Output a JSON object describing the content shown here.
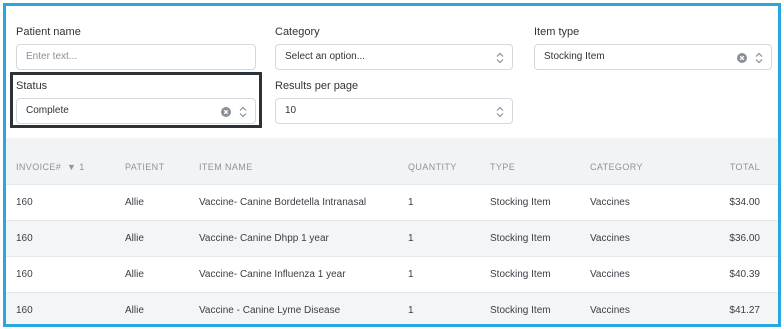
{
  "filters": {
    "patient_name": {
      "label": "Patient name",
      "placeholder": "Enter text..."
    },
    "category": {
      "label": "Category",
      "value": "Select an option..."
    },
    "item_type": {
      "label": "Item type",
      "value": "Stocking Item"
    },
    "status": {
      "label": "Status",
      "value": "Complete"
    },
    "results_per_page": {
      "label": "Results per page",
      "value": "10"
    }
  },
  "table": {
    "headers": {
      "invoice": "INVOICE#",
      "sort_indicator": "▼ 1",
      "patient": "PATIENT",
      "item_name": "ITEM NAME",
      "quantity": "QUANTITY",
      "type": "TYPE",
      "category": "CATEGORY",
      "total": "TOTAL"
    },
    "rows": [
      {
        "invoice": "160",
        "patient": "Allie",
        "item_name": "Vaccine- Canine Bordetella Intranasal",
        "quantity": "1",
        "type": "Stocking Item",
        "category": "Vaccines",
        "total": "$34.00"
      },
      {
        "invoice": "160",
        "patient": "Allie",
        "item_name": "Vaccine- Canine Dhpp 1 year",
        "quantity": "1",
        "type": "Stocking Item",
        "category": "Vaccines",
        "total": "$36.00"
      },
      {
        "invoice": "160",
        "patient": "Allie",
        "item_name": "Vaccine- Canine Influenza 1 year",
        "quantity": "1",
        "type": "Stocking Item",
        "category": "Vaccines",
        "total": "$40.39"
      },
      {
        "invoice": "160",
        "patient": "Allie",
        "item_name": "Vaccine - Canine Lyme Disease",
        "quantity": "1",
        "type": "Stocking Item",
        "category": "Vaccines",
        "total": "$41.27"
      }
    ]
  },
  "colors": {
    "frame_border": "#29a8e0",
    "highlight_border": "#2c3338"
  }
}
